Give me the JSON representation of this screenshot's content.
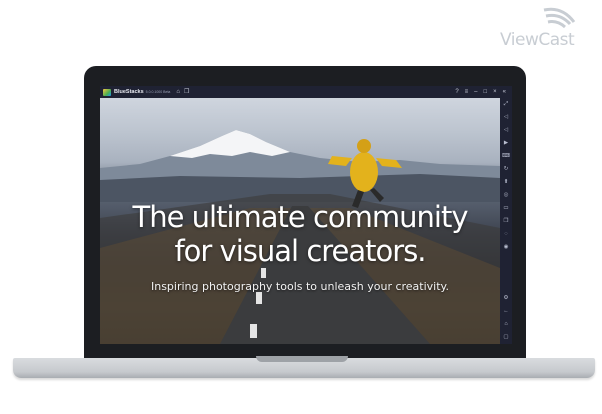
{
  "watermark": {
    "text": "ViewCast"
  },
  "window": {
    "app_name": "BlueStacks",
    "app_version": "5.0.0.1000 Beta"
  },
  "hero": {
    "headline_line1": "The ultimate community",
    "headline_line2": "for visual creators.",
    "subheadline": "Inspiring photography tools to unleash your creativity."
  },
  "colors": {
    "frame_bezel": "#1c1e22",
    "titlebar_bg": "#1f2233",
    "jacket_yellow": "#e3b21c",
    "snow": "#f4f5f7"
  },
  "icons": {
    "titlebar_left": [
      "home-icon",
      "multi-instance-icon"
    ],
    "titlebar_right": [
      "help-icon",
      "menu-icon",
      "minimize-icon",
      "maximize-icon",
      "close-icon",
      "collapse-sidebar-icon"
    ],
    "sidebar": [
      "fullscreen-icon",
      "volume-up-icon",
      "volume-down-icon",
      "video-icon",
      "keyboard-icon",
      "rotate-icon",
      "install-apk-icon",
      "screenshot-icon",
      "folder-icon",
      "copy-icon",
      "eco-mode-icon",
      "location-icon",
      "settings-icon",
      "back-icon",
      "home-nav-icon",
      "recents-icon"
    ]
  }
}
